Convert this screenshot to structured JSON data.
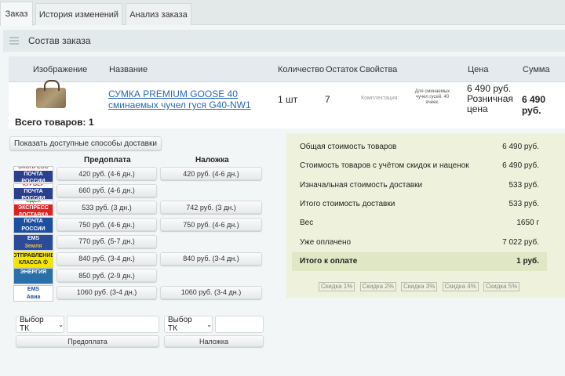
{
  "tabs": [
    "Заказ",
    "История изменений",
    "Анализ заказа"
  ],
  "panel_title": "Состав заказа",
  "table": {
    "headers": [
      "Изображение",
      "Название",
      "Количество",
      "Остаток",
      "Свойства",
      "Цена",
      "Сумма"
    ],
    "row": {
      "name_line1": "СУМКА PREMIUM GOOSE 40",
      "name_line2": "сминаемых чучел гуся G40-NW1",
      "qty": "1 шт",
      "stock": "7",
      "prop_label": "Комплектация:",
      "prop_value": "Для сминаемых чучел гусей. 40 ячеек.",
      "price": "6 490 руб.",
      "price_type_1": "Розничная",
      "price_type_2": "цена",
      "sum": "6 490 руб."
    },
    "total": "Всего товаров: 1"
  },
  "delivery": {
    "show_button": "Показать доступные способы доставки",
    "col_prepay": "Предоплата",
    "col_cod": "Наложка",
    "rows": [
      {
        "logo": [
          "ЭКСПРЕСС",
          "ПОЧТА РОССИИ"
        ],
        "prepay": "420 руб. (4-6 дн.)",
        "cod": "420 руб. (4-6 дн.)"
      },
      {
        "logo": [
          "КУРЬЕР",
          "ПОЧТА РОССИИ"
        ],
        "prepay": "660 руб. (4-6 дн.)",
        "cod": ""
      },
      {
        "logo": [
          "СДЕК",
          "ЭКСПРЕСС ДОСТАВКА"
        ],
        "prepay": "533 руб. (3 дн.)",
        "cod": "742 руб. (3 дн.)"
      },
      {
        "logo": [
          "ПОЧТА",
          "РОССИИ"
        ],
        "prepay": "750 руб. (4-6 дн.)",
        "cod": "750 руб. (4-6 дн.)"
      },
      {
        "logo": [
          "EMS",
          "Земля"
        ],
        "prepay": "770 руб. (5-7 дн.)",
        "cod": ""
      },
      {
        "logo": [
          "ОТПРАВЛЕНИЕ",
          "КЛАССА ①"
        ],
        "prepay": "840 руб. (3-4 дн.)",
        "cod": "840 руб. (3-4 дн.)"
      },
      {
        "logo": [
          "ЭНЕРГИЯ",
          ""
        ],
        "prepay": "850 руб. (2-9 дн.)",
        "cod": ""
      },
      {
        "logo": [
          "EMS",
          "Авиа"
        ],
        "prepay": "1060 руб. (3-4 дн.)",
        "cod": "1060 руб. (3-4 дн.)"
      }
    ],
    "select_label": "Выбор ТК",
    "prepay_button": "Предоплата",
    "cod_button": "Наложка"
  },
  "summary": {
    "rows": [
      {
        "label": "Общая стоимость товаров",
        "value": "6 490 руб."
      },
      {
        "label": "Стоимость товаров с учётом скидок и наценок",
        "value": "6 490 руб."
      },
      {
        "label": "Изначальная стоимость доставки",
        "value": "533 руб."
      },
      {
        "label": "Итого стоимость доставки",
        "value": "533 руб."
      },
      {
        "label": "Вес",
        "value": "1650 г"
      },
      {
        "label": "Уже оплачено",
        "value": "7 022 руб."
      }
    ],
    "total_label": "Итого к оплате",
    "total_value": "1 руб.",
    "discounts": [
      "Скидка 1%",
      "Скидка 2%",
      "Скидка 3%",
      "Скидка 4%",
      "Скидка 5%"
    ]
  }
}
